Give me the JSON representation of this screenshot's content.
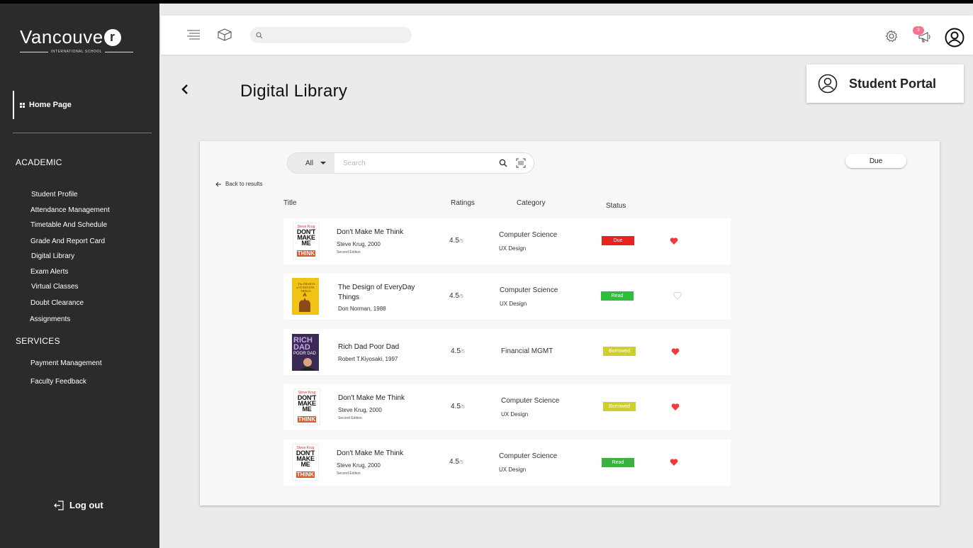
{
  "brand": {
    "name": "Vancouve",
    "r": "r",
    "sub": "INTERNATIONAL SCHOOL"
  },
  "sidebar": {
    "home": "Home Page",
    "academic_title": "ACADEMIC",
    "academic_items": [
      "Student Profile",
      "Attendance Management",
      "Timetable And Schedule",
      "Grade And Report Card",
      "Digital Library",
      "Exam Alerts",
      "Virtual Classes",
      "Doubt Clearance",
      "Assignments"
    ],
    "services_title": "SERVICES",
    "services_items": [
      "Payment Management",
      "Faculty Feedback"
    ],
    "logout": "Log out"
  },
  "topbar": {
    "notification_count": "3"
  },
  "page": {
    "title": "Digital Library",
    "portal": "Student Portal"
  },
  "library": {
    "filter": "All",
    "search_placeholder": "Search",
    "due_button": "Due",
    "back_link": "Back to results",
    "columns": {
      "title": "Title",
      "ratings": "Ratings",
      "category": "Category",
      "status": "Status"
    },
    "books": [
      {
        "title": "Don't Make Me Think",
        "author": "Steve Krug, 2000",
        "edition": "Second Edition",
        "rating": "4.5",
        "rating_max": "/5",
        "category": "Computer Science",
        "subcategory": "UX Design",
        "status": "Due",
        "status_color": "#e8231d",
        "favorite": true
      },
      {
        "title": "The Design of EveryDay Things",
        "author": "Don Norman, 1988",
        "edition": "",
        "rating": "4.5",
        "rating_max": "/5",
        "category": "Computer Science",
        "subcategory": "UX Design",
        "status": "Read",
        "status_color": "#2dbe3a",
        "favorite": false
      },
      {
        "title": "Rich Dad Poor Dad",
        "author": "Robert T.Kiyosaki, 1997",
        "edition": "",
        "rating": "4.5",
        "rating_max": "/5",
        "category": "Financial MGMT",
        "subcategory": "",
        "status": "Borrowed",
        "status_color": "#cfcf2a",
        "favorite": true
      },
      {
        "title": "Don't Make Me Think",
        "author": "Steve Krug, 2000",
        "edition": "Second Edition",
        "rating": "4.5",
        "rating_max": "/5",
        "category": "Computer Science",
        "subcategory": "UX Design",
        "status": "Borrowed",
        "status_color": "#cfcf2a",
        "favorite": true
      },
      {
        "title": "Don't Make Me Think",
        "author": "Steve Krug, 2000",
        "edition": "Second Edition",
        "rating": "4.5",
        "rating_max": "/5",
        "category": "Computer Science",
        "subcategory": "UX Design",
        "status": "Read",
        "status_color": "#3cb043",
        "favorite": true
      }
    ]
  },
  "covers": {
    "dmmt": {
      "author": "Steve Krug",
      "line1": "DON'T",
      "line2": "MAKE",
      "line3": "ME",
      "line4": "THINK"
    },
    "doet": {
      "line1": "The DESIGN",
      "line2": "of EVERYDAY",
      "line3": "THINGS"
    },
    "rich": {
      "line1": "RICH",
      "line2": "DAD",
      "line3": "POOR DAD"
    }
  }
}
